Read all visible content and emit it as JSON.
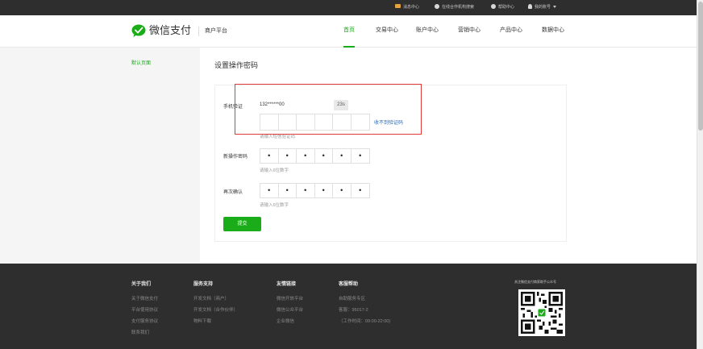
{
  "topbar": {
    "items": [
      {
        "label": "消息中心",
        "icon": "mail-icon"
      },
      {
        "label": "在线合作机构搜索",
        "icon": "gear-icon"
      },
      {
        "label": "帮助中心",
        "icon": "help-icon"
      },
      {
        "label": "我的账号",
        "icon": "user-icon"
      }
    ]
  },
  "header": {
    "logo_text": "微信支付",
    "platform": "商户平台",
    "nav": [
      "首页",
      "交易中心",
      "账户中心",
      "营销中心",
      "产品中心",
      "数据中心"
    ],
    "active_nav": 0,
    "accent_color": "#1aad19"
  },
  "sidebar": {
    "items": [
      "默认页面"
    ]
  },
  "main": {
    "title": "设置操作密码",
    "phone_label": "手机验证",
    "phone_number": "132******00",
    "countdown": "23s",
    "code_hint": "请输入短信验证码",
    "resend_link": "收不到验证码",
    "new_pwd_label": "新操作密码",
    "new_pwd_dots": [
      "•",
      "•",
      "•",
      "•",
      "•",
      "•"
    ],
    "new_pwd_hint": "请输入6位数字",
    "confirm_label": "再次确认",
    "confirm_dots": [
      "•",
      "•",
      "•",
      "•",
      "•",
      "•"
    ],
    "confirm_hint": "请输入6位数字",
    "submit_label": "提交"
  },
  "footer": {
    "columns": [
      {
        "title": "关于我们",
        "links": [
          "关于微信支付",
          "平台使用协议",
          "支付服务协议",
          "联系我们"
        ]
      },
      {
        "title": "服务支持",
        "links": [
          "开发文档（商户）",
          "开发文档（合作伙伴）",
          "物料下载"
        ]
      },
      {
        "title": "友情链接",
        "links": [
          "微信开放平台",
          "微信公众平台",
          "企业微信"
        ]
      },
      {
        "title": "客服帮助",
        "links": [
          "自助服务专区",
          "客服：95017-2",
          "（工作时间：09:00-22:00)"
        ]
      }
    ],
    "qr_caption": "关注微信支付商家助手公众号"
  }
}
